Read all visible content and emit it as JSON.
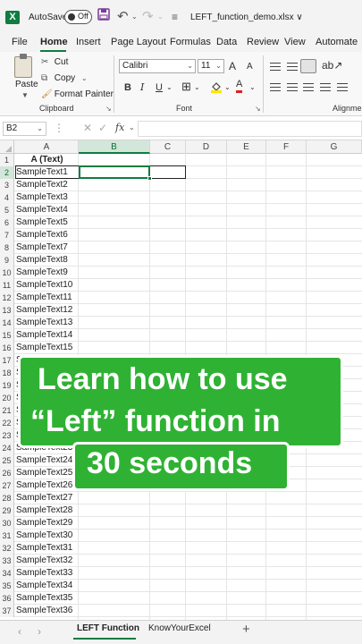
{
  "titlebar": {
    "autosave_label": "AutoSave",
    "autosave_state": "Off",
    "file_name": "LEFT_function_demo.xlsx",
    "file_chevron": "∨"
  },
  "menu": [
    "File",
    "Home",
    "Insert",
    "Page Layout",
    "Formulas",
    "Data",
    "Review",
    "View",
    "Automate"
  ],
  "ribbon": {
    "paste_label": "Paste",
    "cut_label": "Cut",
    "copy_label": "Copy",
    "format_painter_label": "Format Painter",
    "clipboard_group": "Clipboard",
    "font_group": "Font",
    "alignment_group": "Alignmer",
    "font_name": "Calibri",
    "font_size": "11",
    "bold": "B",
    "italic": "I",
    "underline": "U",
    "font_color_glyph": "A",
    "grow_font": "A",
    "shrink_font": "A"
  },
  "formula_bar": {
    "name_box": "B2",
    "fx_label": "fx",
    "formula": ""
  },
  "columns": [
    "A",
    "B",
    "C",
    "D",
    "E",
    "F",
    "G"
  ],
  "selected_column": "B",
  "selected_row": 2,
  "rows": [
    {
      "n": "1",
      "a": "A (Text)"
    },
    {
      "n": "2",
      "a": "SampleText1"
    },
    {
      "n": "3",
      "a": "SampleText2"
    },
    {
      "n": "4",
      "a": "SampleText3"
    },
    {
      "n": "5",
      "a": "SampleText4"
    },
    {
      "n": "6",
      "a": "SampleText5"
    },
    {
      "n": "7",
      "a": "SampleText6"
    },
    {
      "n": "8",
      "a": "SampleText7"
    },
    {
      "n": "9",
      "a": "SampleText8"
    },
    {
      "n": "10",
      "a": "SampleText9"
    },
    {
      "n": "11",
      "a": "SampleText10"
    },
    {
      "n": "12",
      "a": "SampleText11"
    },
    {
      "n": "13",
      "a": "SampleText12"
    },
    {
      "n": "14",
      "a": "SampleText13"
    },
    {
      "n": "15",
      "a": "SampleText14"
    },
    {
      "n": "16",
      "a": "SampleText15"
    },
    {
      "n": "17",
      "a": "SampleText16"
    },
    {
      "n": "18",
      "a": "SampleText17"
    },
    {
      "n": "19",
      "a": "SampleText18"
    },
    {
      "n": "20",
      "a": "SampleText19"
    },
    {
      "n": "21",
      "a": "SampleText20"
    },
    {
      "n": "22",
      "a": "SampleText21"
    },
    {
      "n": "23",
      "a": "SampleText22"
    },
    {
      "n": "24",
      "a": "SampleText23"
    },
    {
      "n": "25",
      "a": "SampleText24"
    },
    {
      "n": "26",
      "a": "SampleText25"
    },
    {
      "n": "27",
      "a": "SampleText26"
    },
    {
      "n": "28",
      "a": "SampleText27"
    },
    {
      "n": "29",
      "a": "SampleText28"
    },
    {
      "n": "30",
      "a": "SampleText29"
    },
    {
      "n": "31",
      "a": "SampleText30"
    },
    {
      "n": "32",
      "a": "SampleText31"
    },
    {
      "n": "33",
      "a": "SampleText32"
    },
    {
      "n": "34",
      "a": "SampleText33"
    },
    {
      "n": "35",
      "a": "SampleText34"
    },
    {
      "n": "36",
      "a": "SampleText35"
    },
    {
      "n": "37",
      "a": "SampleText36"
    }
  ],
  "overlay": {
    "line1": "Learn how to use",
    "line2": "“Left” function in",
    "line3": "30 seconds",
    "color": "#2fb233"
  },
  "sheets": [
    "LEFT Function",
    "KnowYourExcel"
  ],
  "add_sheet": "+",
  "accent_color": "#107c41"
}
